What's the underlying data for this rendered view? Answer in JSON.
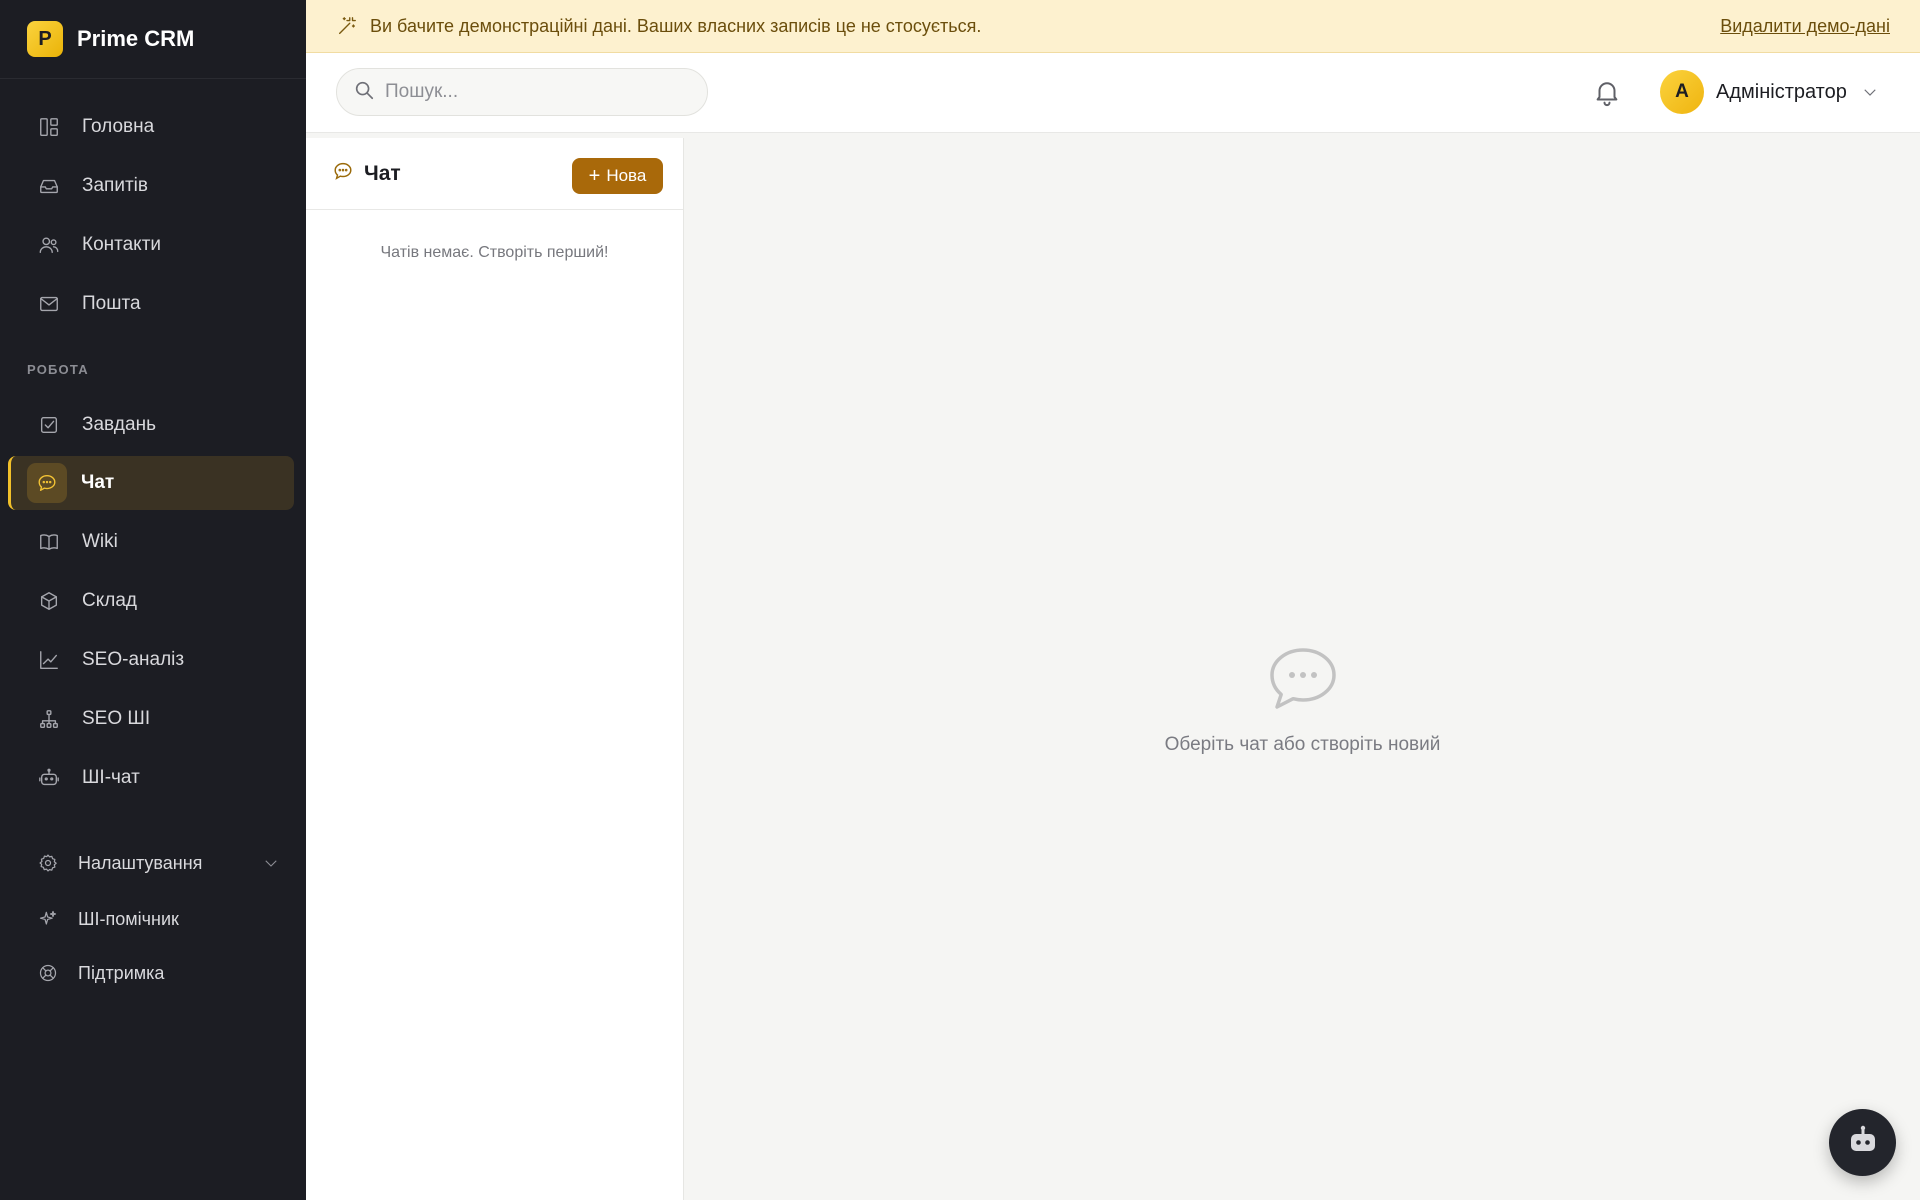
{
  "app": {
    "logo_letter": "P",
    "name": "Prime CRM"
  },
  "sidebar": {
    "items": [
      {
        "label": "Головна",
        "icon": "dashboard-icon"
      },
      {
        "label": "Запитів",
        "icon": "inbox-icon"
      },
      {
        "label": "Контакти",
        "icon": "users-icon"
      },
      {
        "label": "Пошта",
        "icon": "mail-icon"
      }
    ],
    "section_label": "РОБОТА",
    "work_items": [
      {
        "label": "Завдань",
        "icon": "checkbox-icon"
      },
      {
        "label": "Чат",
        "icon": "chat-icon",
        "active": true
      },
      {
        "label": "Wiki",
        "icon": "book-icon"
      },
      {
        "label": "Склад",
        "icon": "box-icon"
      },
      {
        "label": "SEO-аналіз",
        "icon": "chart-icon"
      },
      {
        "label": "SEO ШІ",
        "icon": "network-icon"
      },
      {
        "label": "ШІ-чат",
        "icon": "robot-icon"
      }
    ],
    "bottom_items": [
      {
        "label": "Налаштування",
        "icon": "gear-icon"
      },
      {
        "label": "ШІ-помічник",
        "icon": "sparkle-icon"
      },
      {
        "label": "Підтримка",
        "icon": "lifebuoy-icon"
      }
    ]
  },
  "banner": {
    "text": "Ви бачите демонстраційні дані. Ваших власних записів це не стосується.",
    "action": "Видалити демо-дані"
  },
  "search": {
    "placeholder": "Пошук...",
    "value": ""
  },
  "user": {
    "initial": "А",
    "name": "Адміністратор"
  },
  "chat_list": {
    "title": "Чат",
    "new_button": "Нова",
    "empty_text": "Чатів немає. Створіть перший!"
  },
  "chat_main": {
    "placeholder": "Оберіть чат або створіть новий"
  },
  "colors": {
    "accent": "#a9690a",
    "brand": "#fbd33e",
    "sidebar_bg": "#1c1d23",
    "banner_bg": "#fdf1cf"
  }
}
